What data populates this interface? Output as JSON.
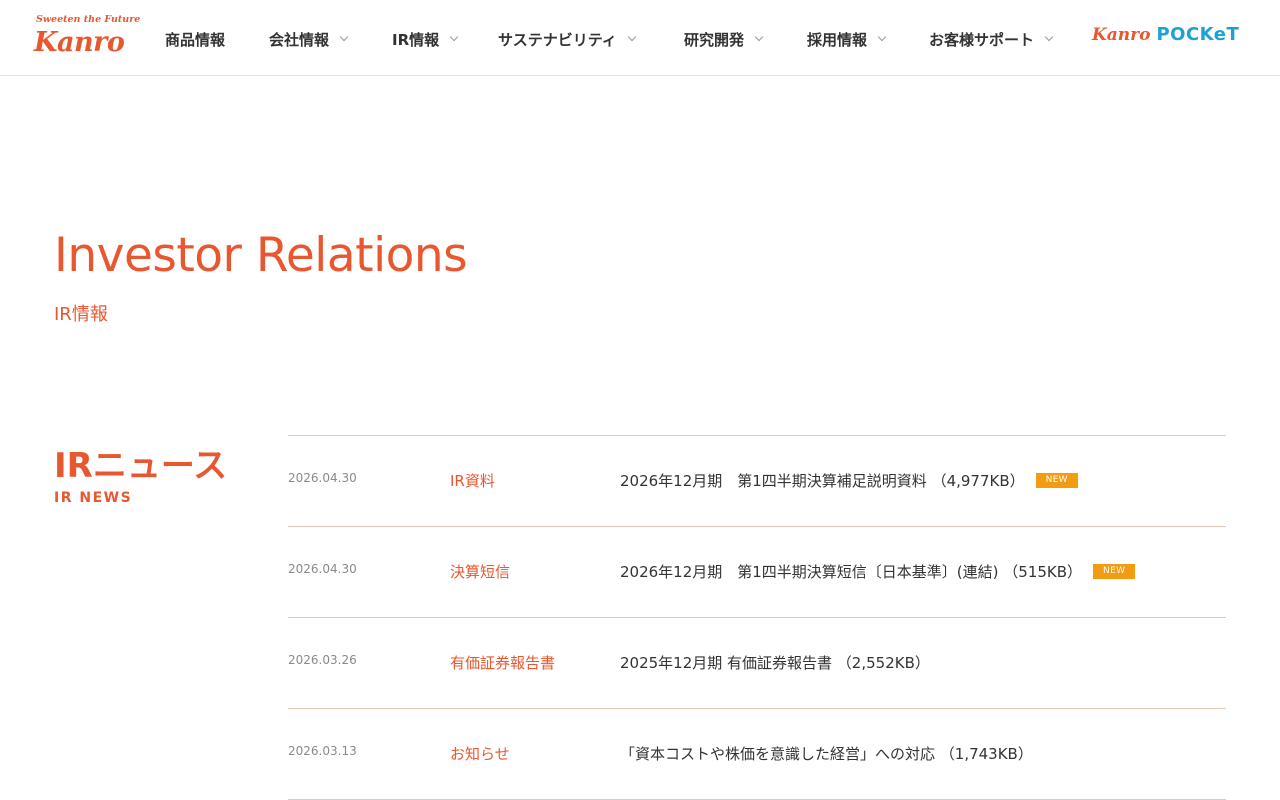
{
  "brand": {
    "tagline": "Sweeten the Future",
    "name": "Kanro",
    "pocket_brand": "Kanro",
    "pocket_name": "POCKeT",
    "accent_color": "#e8572f",
    "pocket_color": "#1ba2d4"
  },
  "nav": {
    "items": [
      {
        "label": "商品情報",
        "has_dropdown": false
      },
      {
        "label": "会社情報",
        "has_dropdown": true
      },
      {
        "label": "IR情報",
        "has_dropdown": true
      },
      {
        "label": "サステナビリティ",
        "has_dropdown": true
      },
      {
        "label": "研究開発",
        "has_dropdown": true
      },
      {
        "label": "採用情報",
        "has_dropdown": true
      },
      {
        "label": "お客様サポート",
        "has_dropdown": true
      }
    ]
  },
  "hero": {
    "title": "Investor Relations",
    "subtitle": "IR情報"
  },
  "news": {
    "heading": "IRニュース",
    "subheading": "IR NEWS",
    "new_badge_color": "#f39c12",
    "items": [
      {
        "date": "2026.04.30",
        "category": "IR資料",
        "title": "2026年12月期　第1四半期決算補足説明資料 （4,977KB）",
        "badge": "NEW"
      },
      {
        "date": "2026.04.30",
        "category": "決算短信",
        "title": "2026年12月期　第1四半期決算短信〔日本基準〕(連結) （515KB）",
        "badge": "NEW"
      },
      {
        "date": "2026.03.26",
        "category": "有価証券報告書",
        "title": "2025年12月期 有価証券報告書 （2,552KB）",
        "badge": ""
      },
      {
        "date": "2026.03.13",
        "category": "お知らせ",
        "title": "「資本コストや株価を意識した経営」への対応 （1,743KB）",
        "badge": ""
      }
    ]
  }
}
